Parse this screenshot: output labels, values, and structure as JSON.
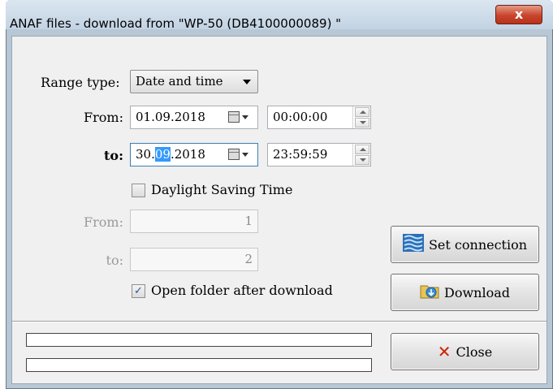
{
  "window": {
    "title": "ANAF files - download from \"WP-50 (DB4100000089) \"",
    "close_glyph": "x"
  },
  "range_type": {
    "label": "Range type:",
    "value": "Date and time"
  },
  "date_from": {
    "label": "From:",
    "date": "01.09.2018",
    "time": "00:00:00"
  },
  "date_to": {
    "label": "to:",
    "date_prefix": "30.",
    "date_selected": "09",
    "date_suffix": ".2018",
    "time": "23:59:59"
  },
  "dst": {
    "label": "Daylight Saving Time",
    "checked": false
  },
  "number_from": {
    "label": "From:",
    "value": "1"
  },
  "number_to": {
    "label": "to:",
    "value": "2"
  },
  "open_folder": {
    "label": "Open folder after download",
    "checked": true,
    "check_glyph": "✓"
  },
  "buttons": {
    "set_connection": "Set connection",
    "download": "Download",
    "close": "Close",
    "close_glyph": "✕"
  },
  "progress": {
    "bar1_fraction": 0,
    "bar2_fraction": 0
  },
  "colors": {
    "selection": "#3399ff",
    "title_close": "#c8452c",
    "close_icon": "#cc2200"
  },
  "icons": {
    "set_connection": "network-connection-icon",
    "download": "folder-download-icon",
    "close": "close-x-icon",
    "calendar": "calendar-icon"
  }
}
